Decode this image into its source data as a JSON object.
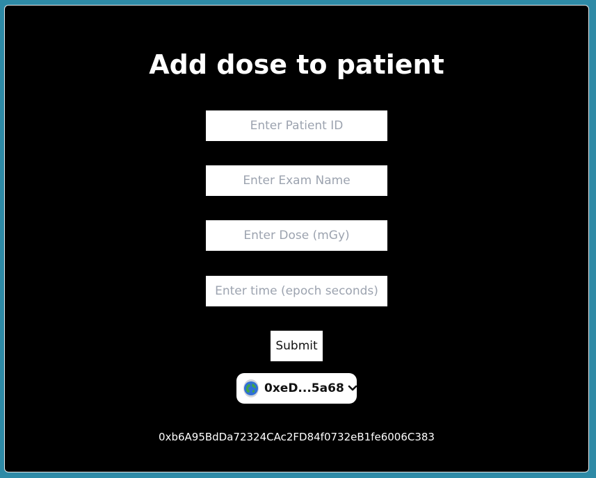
{
  "page": {
    "title": "Add dose to patient",
    "contract_address": "0xb6A95BdDa72324CAc2FD84f0732eB1fe6006C383"
  },
  "form": {
    "patient_id": {
      "value": "",
      "placeholder": "Enter Patient ID"
    },
    "exam_name": {
      "value": "",
      "placeholder": "Enter Exam Name"
    },
    "dose": {
      "value": "",
      "placeholder": "Enter Dose (mGy)"
    },
    "time": {
      "value": "",
      "placeholder": "Enter time (epoch seconds)"
    },
    "submit_label": "Submit"
  },
  "wallet": {
    "account_label": "0xeD...5a68",
    "avatar_icon": "globe-icon",
    "chevron_icon": "chevron-down-icon"
  },
  "colors": {
    "outer_background": "#2e8aa6",
    "card_background": "#000000",
    "text": "#ffffff",
    "input_background": "#ffffff",
    "placeholder": "#9ca3af"
  }
}
